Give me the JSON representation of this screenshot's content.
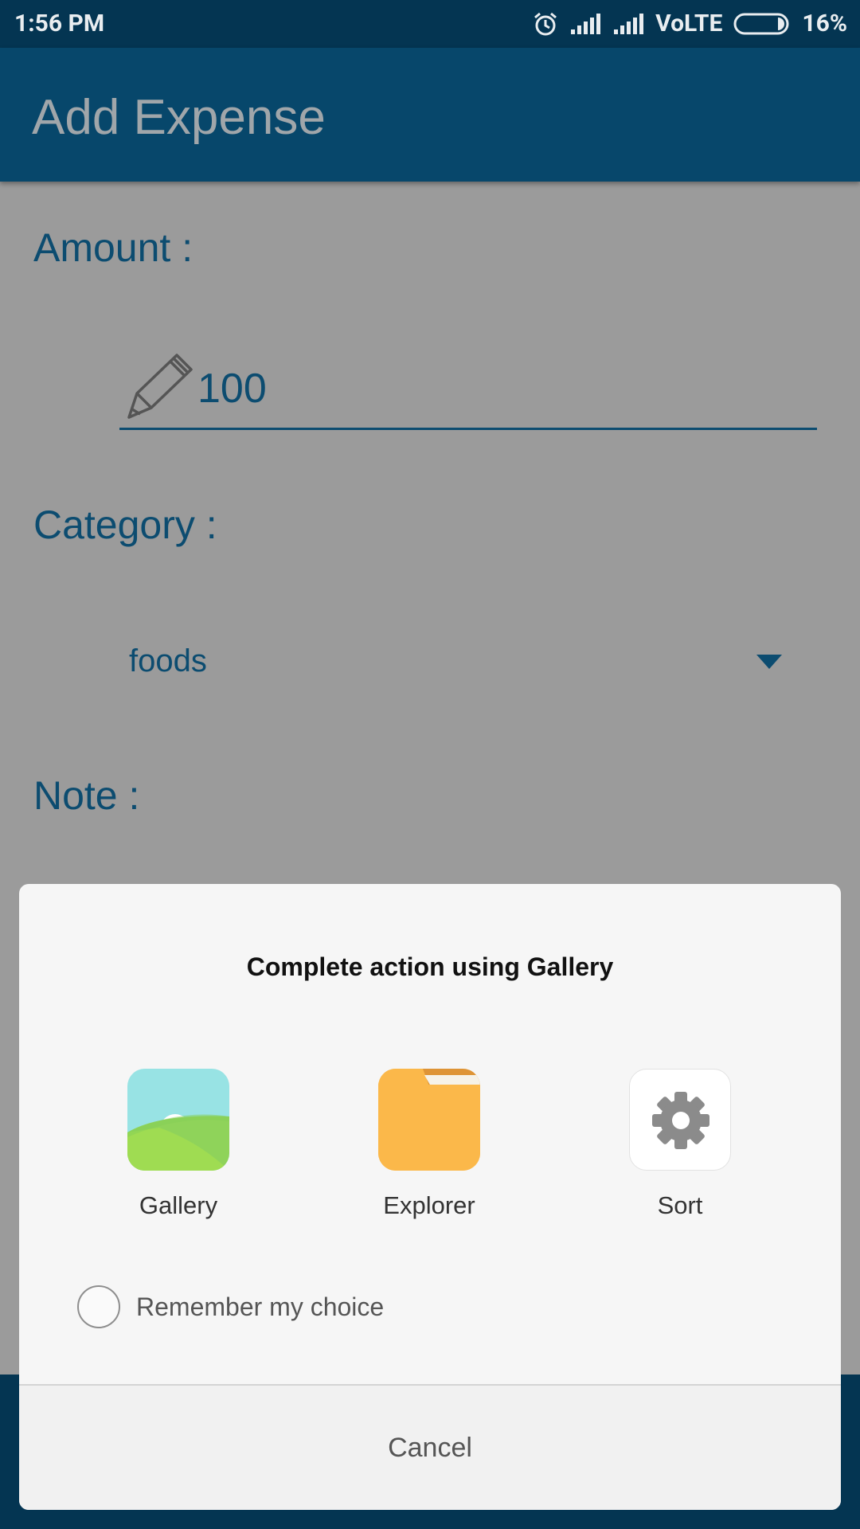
{
  "status_bar": {
    "time": "1:56 PM",
    "network": "VoLTE",
    "battery": "16%",
    "battery_level": 0.16
  },
  "app_bar": {
    "title": "Add Expense"
  },
  "form": {
    "amount_label": "Amount :",
    "amount_value": "100",
    "category_label": "Category :",
    "category_value": "foods",
    "note_label": "Note :"
  },
  "dialog": {
    "title": "Complete action using Gallery",
    "apps": [
      {
        "label": "Gallery",
        "icon": "gallery-icon"
      },
      {
        "label": "Explorer",
        "icon": "folder-icon"
      },
      {
        "label": "Sort",
        "icon": "gear-icon"
      }
    ],
    "remember_label": "Remember my choice",
    "cancel_label": "Cancel"
  },
  "colors": {
    "primary": "#07476b",
    "primary_dark": "#043552",
    "scrim": "#9b9b9b",
    "dialog_bg": "#f6f6f6",
    "gallery_sky": "#98e3e4",
    "gallery_hill": "#8fd35a",
    "folder": "#fbb84a"
  }
}
